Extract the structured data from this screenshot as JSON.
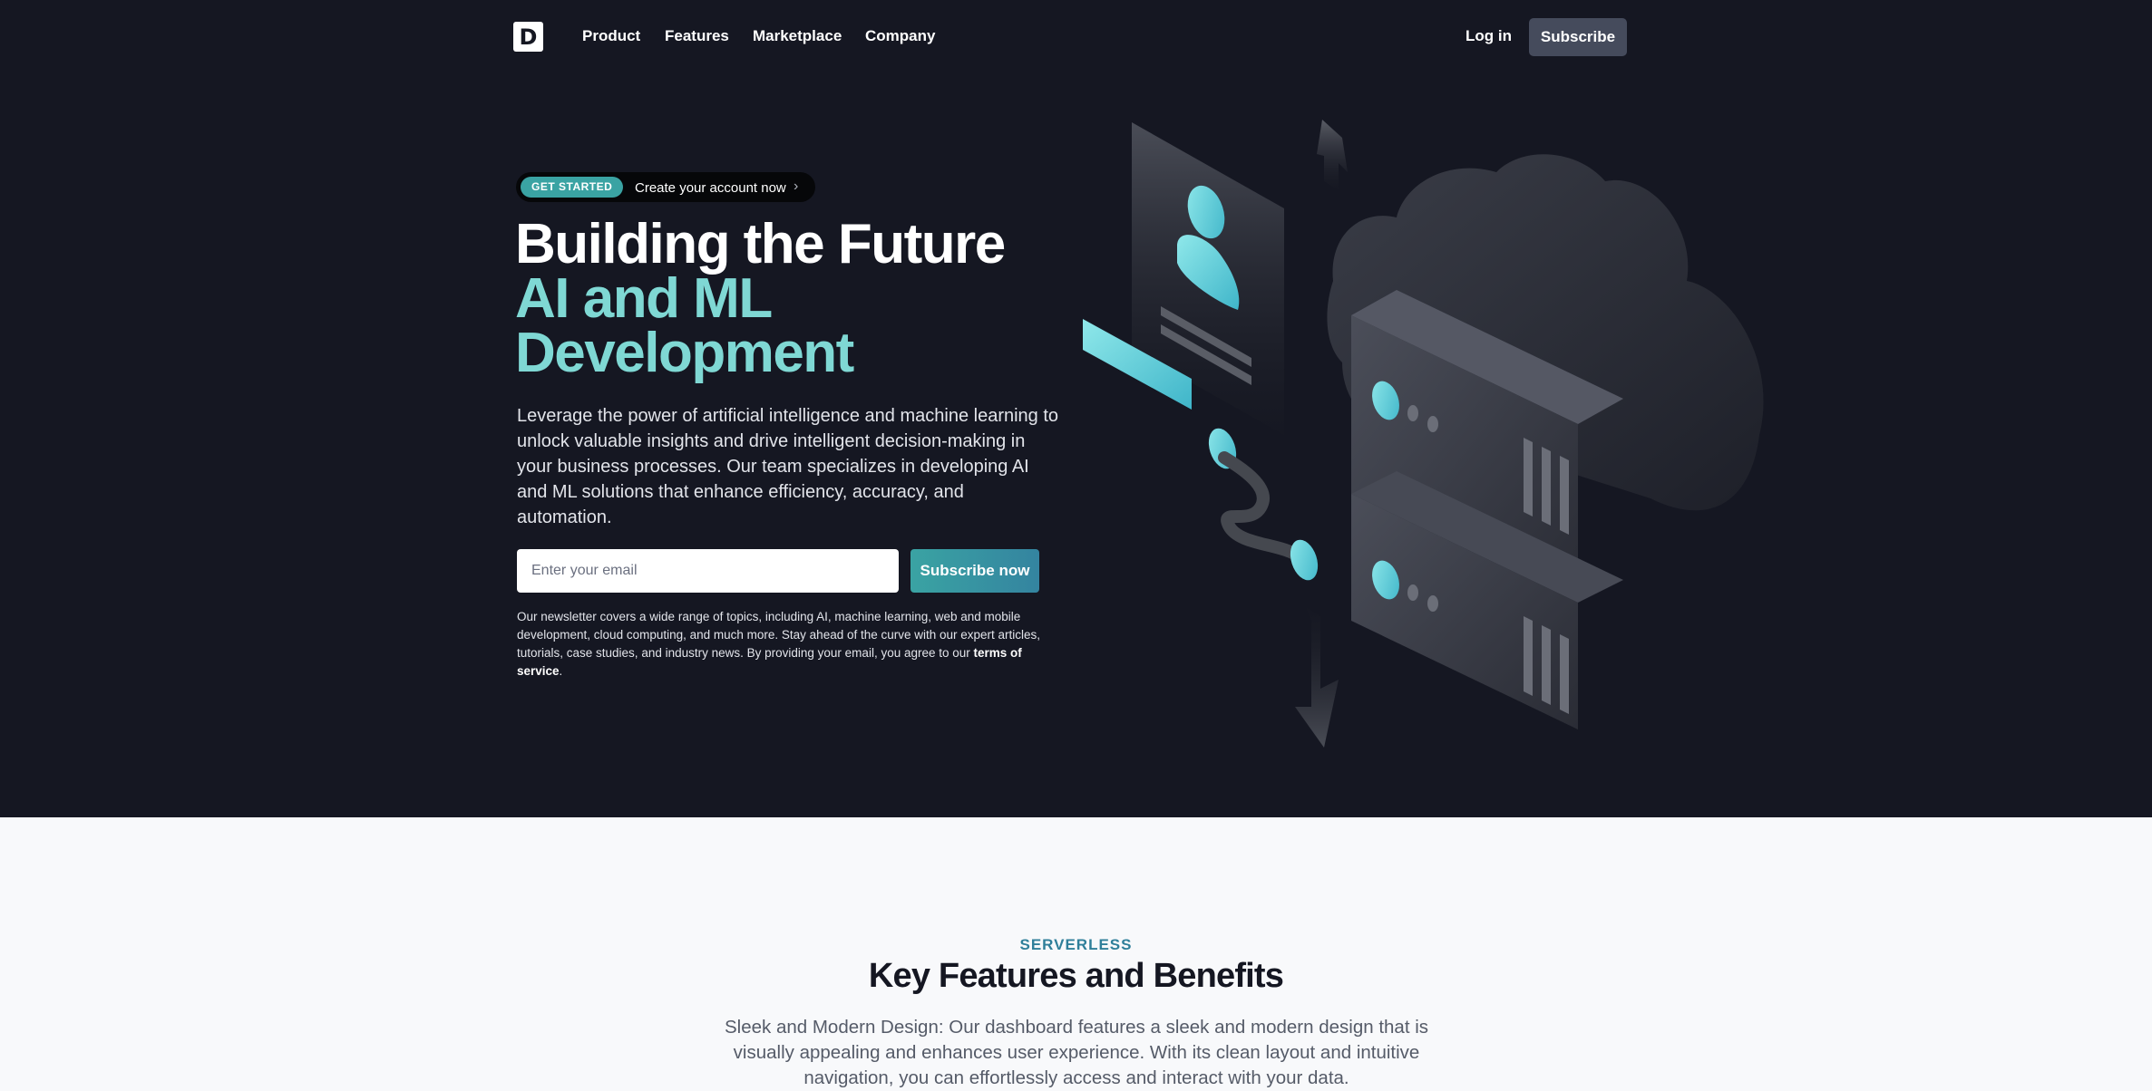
{
  "nav": {
    "logo_letter": "D",
    "links": [
      "Product",
      "Features",
      "Marketplace",
      "Company"
    ],
    "login_label": "Log in",
    "subscribe_label": "Subscribe"
  },
  "hero": {
    "badge": "GET STARTED",
    "badge_text": "Create your account now",
    "headline_line1": "Building the Future",
    "headline_line2": "AI and ML",
    "headline_line3": "Development",
    "lead": "Leverage the power of artificial intelligence and machine learning to unlock valuable insights and drive intelligent decision-making in your business processes. Our team specializes in developing AI and ML solutions that enhance efficiency, accuracy, and automation.",
    "email_placeholder": "Enter your email",
    "email_value": "",
    "cta_label": "Subscribe now",
    "fineprint": "Our newsletter covers a wide range of topics, including AI, machine learning, web and mobile development, cloud computing, and much more. Stay ahead of the curve with our expert articles, tutorials, case studies, and industry news. By providing your email, you agree to our ",
    "terms_link": "terms of service",
    "fineprint_end": "."
  },
  "features": {
    "eyebrow": "SERVERLESS",
    "title": "Key Features and Benefits",
    "text": "Sleek and Modern Design: Our dashboard features a sleek and modern design that is visually appealing and enhances user experience. With its clean layout and intuitive navigation, you can effortlessly access and interact with your data."
  },
  "colors": {
    "hero_bg": "#151722",
    "accent_teal": "#7fd8d4",
    "badge_teal": "#3aa3a3",
    "eyebrow_blue": "#2f7f9a"
  },
  "icons": {
    "logo": "brand-logo-icon",
    "pill_chevron": "chevron-right-icon",
    "illustration": "cloud-servers-illustration"
  }
}
